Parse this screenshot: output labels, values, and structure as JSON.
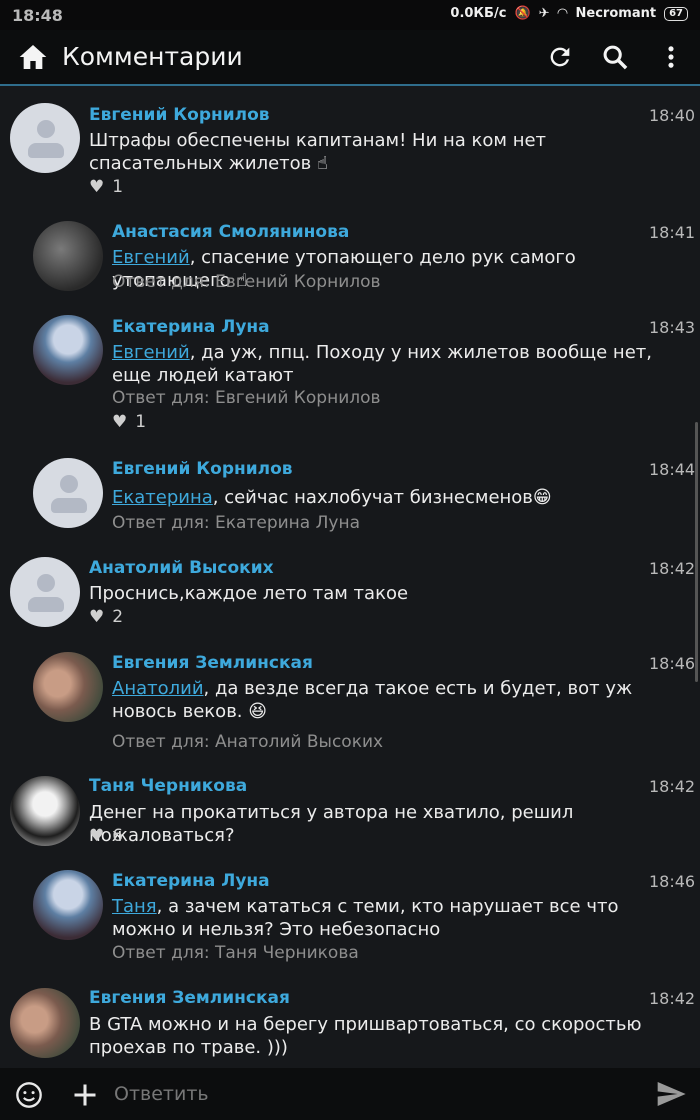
{
  "status": {
    "time": "18:48",
    "network": "0.0КБ/с",
    "carrier": "Necromant",
    "battery": "67"
  },
  "header": {
    "title": "Комментарии"
  },
  "comments": [
    {
      "name": "Евгений Корнилов",
      "time": "18:40",
      "text": "Штрафы обеспечены капитанам! Ни на ком нет спасательных жилетов ☝",
      "likes": "1"
    },
    {
      "name": "Анастасия Смолянинова",
      "time": "18:41",
      "mention": "Евгений",
      "text": ", спасение утопающего дело рук самого утопающего ☝",
      "reply": "Ответ для: Евгений Корнилов"
    },
    {
      "name": "Екатерина Луна",
      "time": "18:43",
      "mention": "Евгений",
      "text": ", да уж, ппц. Походу у них жилетов вообще нет, еще людей катают",
      "reply": "Ответ для: Евгений Корнилов",
      "likes": "1"
    },
    {
      "name": "Евгений Корнилов",
      "time": "18:44",
      "mention": "Екатерина",
      "text": ", сейчас нахлобучат бизнесменов😁",
      "reply": "Ответ для: Екатерина Луна"
    },
    {
      "name": "Анатолий Высоких",
      "time": "18:42",
      "text": "Проснись,каждое лето там такое",
      "likes": "2"
    },
    {
      "name": "Евгения Землинская",
      "time": "18:46",
      "mention": "Анатолий",
      "text": ", да везде всегда такое есть и будет, вот уж новось веков. 😆",
      "reply": "Ответ для: Анатолий Высоких"
    },
    {
      "name": "Таня Черникова",
      "time": "18:42",
      "text": "Денег на прокатиться у автора не хватило, решил пожаловаться?",
      "likes": "6"
    },
    {
      "name": "Екатерина Луна",
      "time": "18:46",
      "mention": "Таня",
      "text": ", а зачем кататься с теми, кто нарушает все что можно и нельзя? Это небезопасно",
      "reply": "Ответ для: Таня Черникова"
    },
    {
      "name": "Евгения Землинская",
      "time": "18:42",
      "text": "В GTA можно и на берегу пришвартоваться, со скоростью проехав по траве. )))"
    }
  ],
  "composer": {
    "placeholder": "Ответить"
  }
}
